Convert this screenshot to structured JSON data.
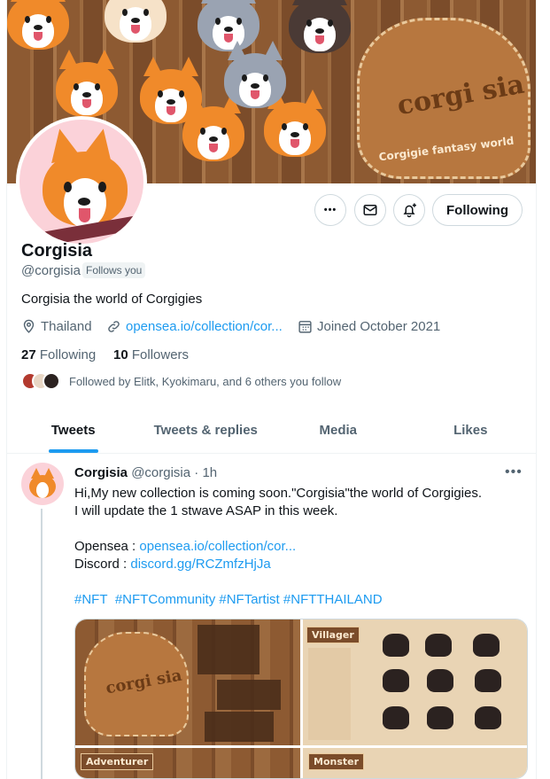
{
  "banner": {
    "logo_text": "corgi sia",
    "logo_subtitle": "Corgigie fantasy world"
  },
  "actions": {
    "more_label": "•••",
    "message_icon": "envelope-icon",
    "notify_icon": "bell-plus-icon",
    "follow_label": "Following"
  },
  "profile": {
    "name": "Corgisia",
    "handle": "@corgisia",
    "follows_you": "Follows you",
    "bio": "Corgisia the world of Corgigies",
    "location": "Thailand",
    "link": "opensea.io/collection/cor...",
    "joined": "Joined October 2021",
    "following_count": "27",
    "following_label": "Following",
    "followers_count": "10",
    "followers_label": "Followers",
    "followed_by": "Followed by Elitk, Kyokimaru, and 6 others you follow"
  },
  "tabs": [
    {
      "label": "Tweets",
      "active": true
    },
    {
      "label": "Tweets & replies",
      "active": false
    },
    {
      "label": "Media",
      "active": false
    },
    {
      "label": "Likes",
      "active": false
    }
  ],
  "tweet": {
    "author": "Corgisia",
    "handle": "@corgisia",
    "time": "· 1h",
    "more": "•••",
    "line1": "Hi,My new collection is coming soon.\"Corgisia\"the world of Corgigies.",
    "line2": "I will update the 1 stwave ASAP in this week.",
    "opensea_label": "Opensea : ",
    "opensea_link": "opensea.io/collection/cor...",
    "discord_label": "Discord : ",
    "discord_link": "discord.gg/RCZmfzHjJa",
    "hashtags": [
      "#NFT",
      "#NFTCommunity",
      "#NFTartist",
      "#NFTTHAILAND"
    ],
    "media_labels": {
      "logo": "corgi sia",
      "villager": "Villager",
      "adventurer": "Adventurer",
      "monster": "Monster"
    }
  },
  "colors": {
    "accent": "#1d9bf0",
    "text_primary": "#0f1419",
    "text_secondary": "#536471",
    "border": "#cfd9de"
  }
}
